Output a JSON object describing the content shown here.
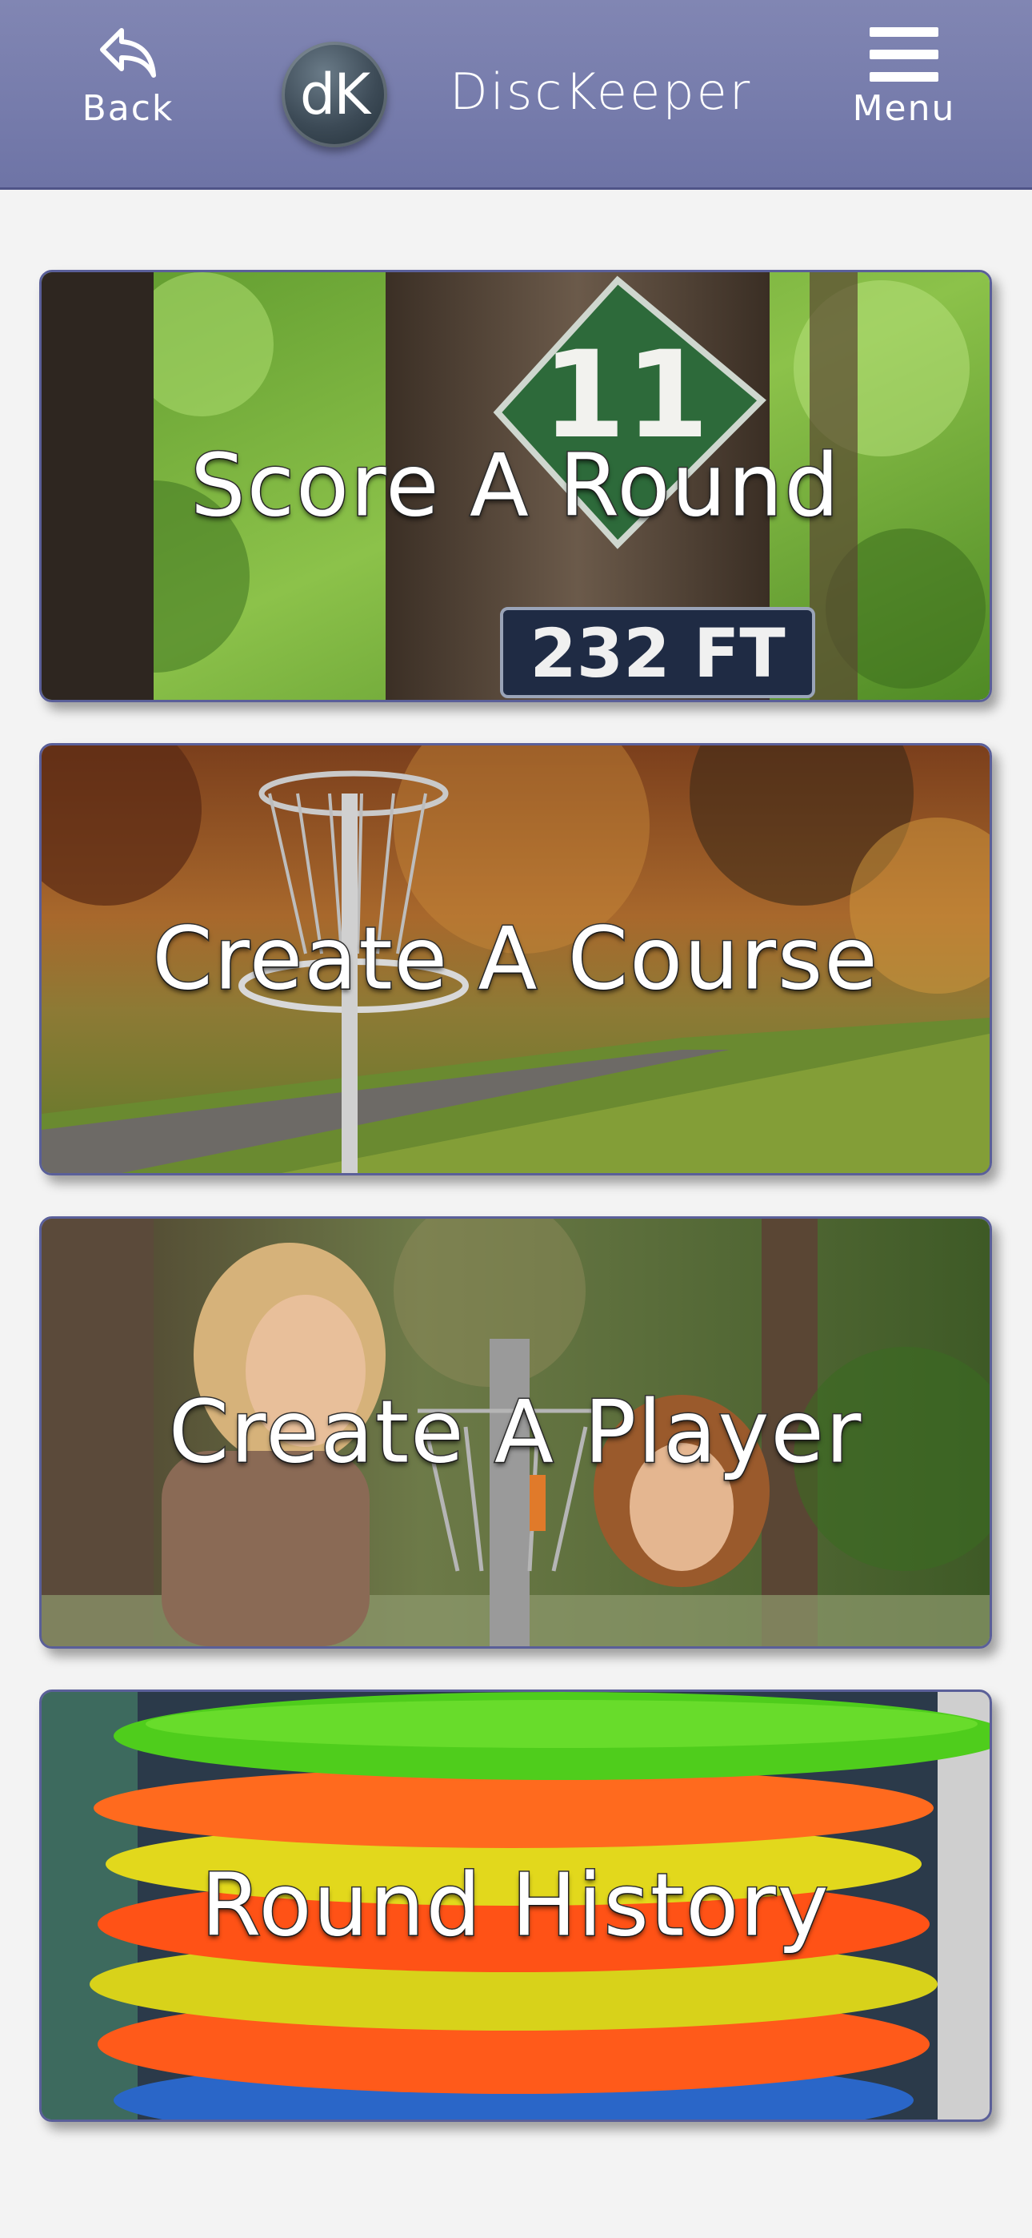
{
  "header": {
    "back_label": "Back",
    "logo_text": "dK",
    "title": "DiscKeeper",
    "menu_label": "Menu"
  },
  "cards": [
    {
      "label": "Score A Round",
      "sign_number": "11",
      "sign_distance": "232 FT"
    },
    {
      "label": "Create A Course"
    },
    {
      "label": "Create A Player"
    },
    {
      "label": "Round History"
    }
  ],
  "colors": {
    "header_bg": "#767bab",
    "header_border": "#4f5488",
    "card_border": "#5a5f99",
    "page_bg": "#f3f3f3"
  },
  "icons": {
    "back": "back-arrow-icon",
    "menu": "hamburger-menu-icon"
  }
}
